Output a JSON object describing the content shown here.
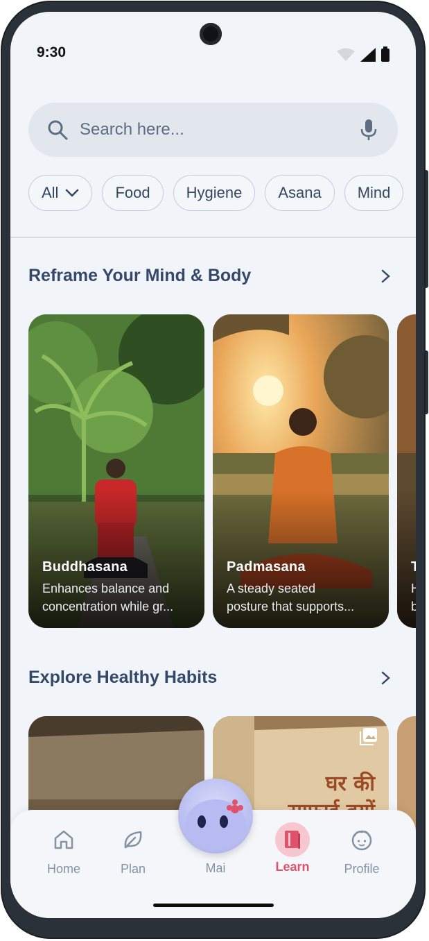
{
  "status_bar": {
    "time": "9:30"
  },
  "search": {
    "placeholder": "Search here..."
  },
  "chips": [
    {
      "label": "All"
    },
    {
      "label": "Food"
    },
    {
      "label": "Hygiene"
    },
    {
      "label": "Asana"
    },
    {
      "label": "Mind"
    }
  ],
  "section_reframe": {
    "title": "Reframe Your Mind & Body",
    "cards": [
      {
        "title": "Buddhasana",
        "desc_line1": "Enhances balance and",
        "desc_line2": "concentration while gr..."
      },
      {
        "title": "Padmasana",
        "desc_line1": "A steady seated",
        "desc_line2": "posture that supports..."
      },
      {
        "title": "T",
        "desc_line1": "H",
        "desc_line2": "b"
      }
    ]
  },
  "section_habits": {
    "title": "Explore Healthy Habits",
    "card2_text_line1": "घर की",
    "card2_text_line2": "साफ़ाई क्यों"
  },
  "nav": {
    "home": "Home",
    "plan": "Plan",
    "mai": "Mai",
    "learn": "Learn",
    "profile": "Profile",
    "active": "Learn"
  },
  "colors": {
    "accent": "#e0516a",
    "title": "#34486a",
    "background": "#f1f4f8"
  }
}
